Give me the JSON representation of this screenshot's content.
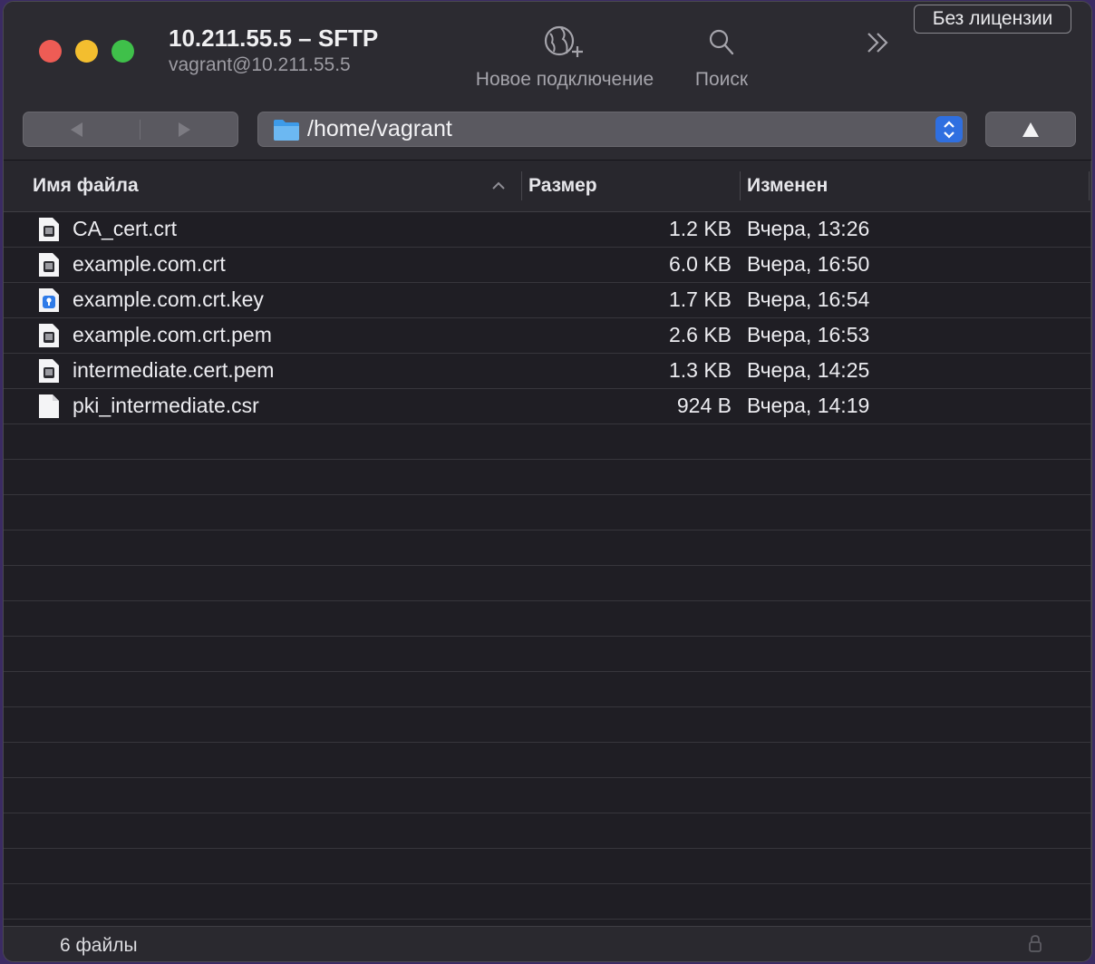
{
  "window": {
    "title": "10.211.55.5 – SFTP",
    "subtitle": "vagrant@10.211.55.5"
  },
  "toolbar": {
    "new_connection_label": "Новое подключение",
    "search_label": "Поиск",
    "license_label": "Без лицензии"
  },
  "path": {
    "current": "/home/vagrant"
  },
  "columns": {
    "name": "Имя файла",
    "size": "Размер",
    "modified": "Изменен",
    "sort": "name-ascending"
  },
  "files": [
    {
      "name": "CA_cert.crt",
      "size": "1.2 KB",
      "modified": "Вчера, 13:26",
      "icon": "certificate-file-icon"
    },
    {
      "name": "example.com.crt",
      "size": "6.0 KB",
      "modified": "Вчера, 16:50",
      "icon": "certificate-file-icon"
    },
    {
      "name": "example.com.crt.key",
      "size": "1.7 KB",
      "modified": "Вчера, 16:54",
      "icon": "key-file-icon"
    },
    {
      "name": "example.com.crt.pem",
      "size": "2.6 KB",
      "modified": "Вчера, 16:53",
      "icon": "certificate-file-icon"
    },
    {
      "name": "intermediate.cert.pem",
      "size": "1.3 KB",
      "modified": "Вчера, 14:25",
      "icon": "certificate-file-icon"
    },
    {
      "name": "pki_intermediate.csr",
      "size": "924 B",
      "modified": "Вчера, 14:19",
      "icon": "blank-file-icon"
    }
  ],
  "status": {
    "file_count": "6 файлы"
  },
  "colors": {
    "accent": "#2f6fe0",
    "close": "#ee5c55",
    "minimize": "#f3be2f",
    "zoom": "#3fc04a",
    "background": "#1f1e24"
  }
}
